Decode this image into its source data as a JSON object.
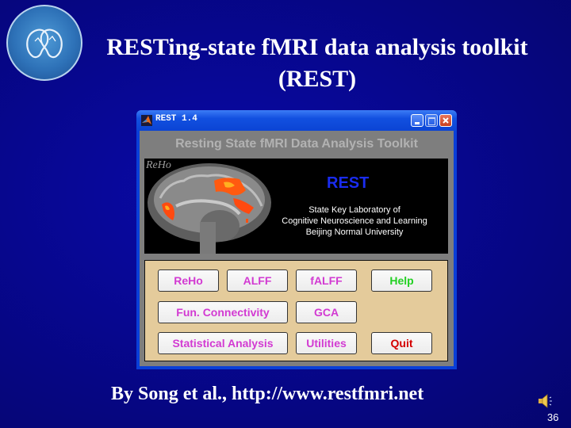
{
  "slide": {
    "title_line1": "RESTing-state fMRI data analysis toolkit",
    "title_line2": "(REST)",
    "byline": "By Song et al., http://www.restfmri.net",
    "page_number": "36",
    "logo_icon": "lab-logo-icon",
    "speaker_icon": "speaker-icon"
  },
  "window": {
    "title": "REST 1.4",
    "controls": {
      "minimize": "minimize-icon",
      "maximize": "maximize-icon",
      "close": "close-icon"
    },
    "heading": "Resting State fMRI Data Analysis Toolkit",
    "image_panel": {
      "overlay_label": "ReHo",
      "logo_text": "REST",
      "lab_lines": [
        "State Key Laboratory of",
        "Cognitive Neuroscience and Learning",
        "Beijing Normal University"
      ]
    },
    "buttons": {
      "reho": "ReHo",
      "alff": "ALFF",
      "falff": "fALFF",
      "help": "Help",
      "fc": "Fun. Connectivity",
      "gca": "GCA",
      "stats": "Statistical Analysis",
      "utilities": "Utilities",
      "quit": "Quit"
    },
    "colors": {
      "button_text": "#d23ad2",
      "help_text": "#22d022",
      "quit_text": "#d40000",
      "panel_bg": "#e4cb9b"
    }
  }
}
